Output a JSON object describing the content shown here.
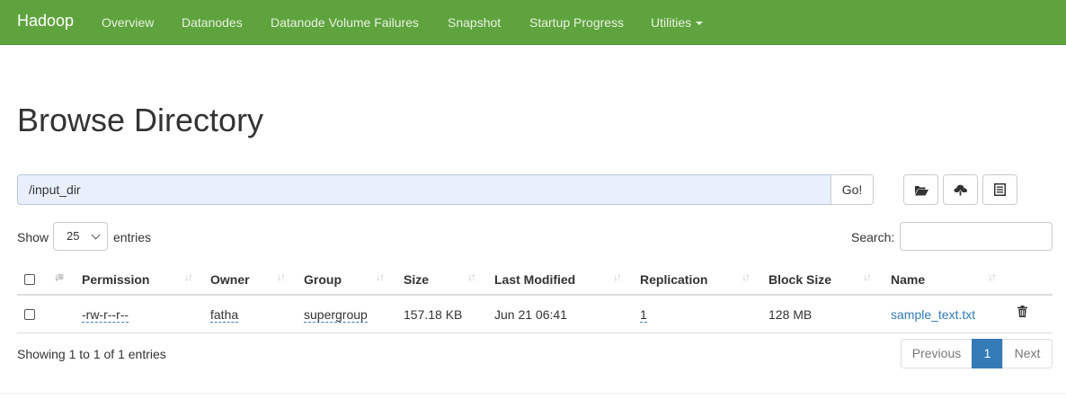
{
  "navbar": {
    "brand": "Hadoop",
    "items": [
      {
        "label": "Overview"
      },
      {
        "label": "Datanodes"
      },
      {
        "label": "Datanode Volume Failures"
      },
      {
        "label": "Snapshot"
      },
      {
        "label": "Startup Progress"
      },
      {
        "label": "Utilities"
      }
    ],
    "color": "#5fa33e"
  },
  "page_title": "Browse Directory",
  "path": {
    "value": "/input_dir",
    "go_label": "Go!"
  },
  "toolbar": {
    "buttons": [
      {
        "icon": "folder-open-icon"
      },
      {
        "icon": "cloud-upload-icon"
      },
      {
        "icon": "list-icon"
      }
    ]
  },
  "controls": {
    "show_label": "Show",
    "entries_value": "25",
    "entries_label": "entries",
    "search_label": "Search:",
    "search_value": ""
  },
  "table": {
    "columns": [
      "Permission",
      "Owner",
      "Group",
      "Size",
      "Last Modified",
      "Replication",
      "Block Size",
      "Name"
    ],
    "rows": [
      {
        "permission": "-rw-r--r--",
        "owner": "fatha",
        "group": "supergroup",
        "size": "157.18 KB",
        "last_modified": "Jun 21 06:41",
        "replication": "1",
        "block_size": "128 MB",
        "name": "sample_text.txt"
      }
    ]
  },
  "footer": {
    "showing": "Showing 1 to 1 of 1 entries",
    "previous_label": "Previous",
    "page": "1",
    "next_label": "Next"
  },
  "colors": {
    "link": "#337ab7",
    "active_page": "#337ab7"
  }
}
